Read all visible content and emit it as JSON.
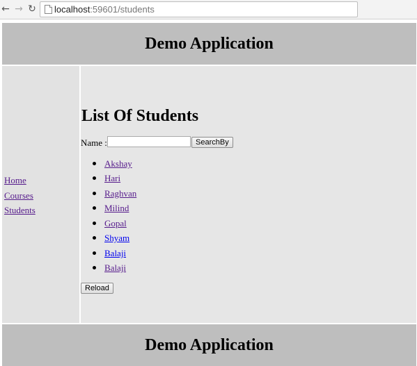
{
  "browser": {
    "url_host": "localhost",
    "url_rest": ":59601/students"
  },
  "header": {
    "title": "Demo Application"
  },
  "sidebar": {
    "items": [
      {
        "label": "Home"
      },
      {
        "label": "Courses"
      },
      {
        "label": "Students"
      }
    ]
  },
  "main": {
    "heading": "List Of Students",
    "search": {
      "label": "Name :",
      "value": "",
      "button": "SearchBy"
    },
    "students": [
      {
        "name": "Akshay"
      },
      {
        "name": "Hari"
      },
      {
        "name": "Raghvan"
      },
      {
        "name": "Milind"
      },
      {
        "name": "Gopal"
      },
      {
        "name": "Shyam"
      },
      {
        "name": "Balaji"
      },
      {
        "name": "Balaji"
      }
    ],
    "reload_button": "Reload"
  },
  "footer": {
    "title": "Demo Application"
  },
  "icons": {
    "back": "back-arrow-icon",
    "forward": "forward-arrow-icon",
    "reload": "reload-icon",
    "page": "page-icon",
    "bullet": "bullet-icon"
  }
}
